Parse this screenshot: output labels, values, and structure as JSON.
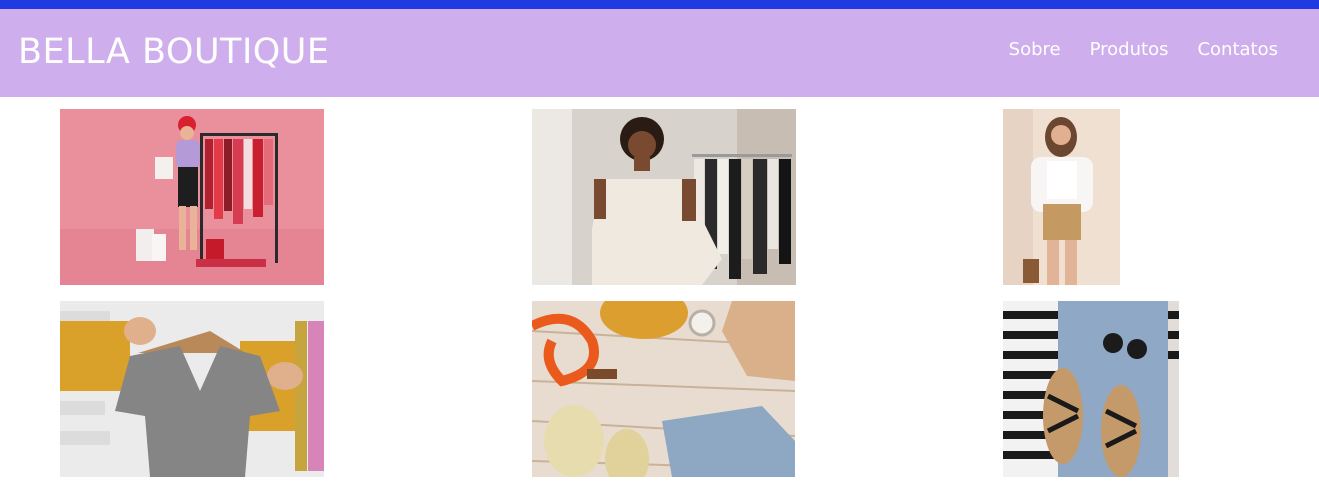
{
  "header": {
    "brand": "BELLA BOUTIQUE",
    "nav": [
      {
        "label": "Sobre"
      },
      {
        "label": "Produtos"
      },
      {
        "label": "Contatos"
      }
    ]
  },
  "colors": {
    "top_stripe": "#1f3ae0",
    "header_bg": "#ceaeec",
    "header_text": "#ffffff",
    "page_bg": "#ffffff"
  },
  "gallery": {
    "images": [
      {
        "name": "woman-red-beret-clothing-rack-photo"
      },
      {
        "name": "woman-holding-white-sweater-photo"
      },
      {
        "name": "woman-white-top-khaki-shorts-photo"
      },
      {
        "name": "gray-tshirt-on-hanger-photo"
      },
      {
        "name": "flatlay-belt-shoes-jeans-photo"
      },
      {
        "name": "flatlay-sandals-jeans-striped-top-photo"
      }
    ]
  }
}
